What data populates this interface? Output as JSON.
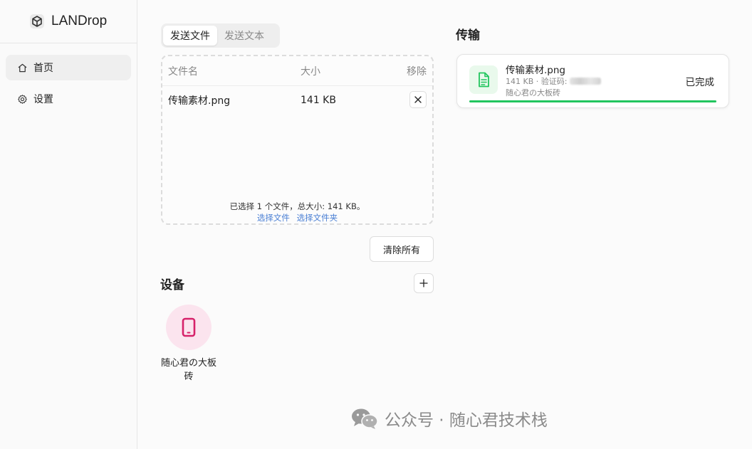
{
  "app": {
    "name": "LANDrop"
  },
  "sidebar": {
    "items": [
      {
        "label": "首页",
        "icon": "home-icon",
        "active": true
      },
      {
        "label": "设置",
        "icon": "gear-icon",
        "active": false
      }
    ]
  },
  "send": {
    "tabs": [
      {
        "label": "发送文件",
        "active": true
      },
      {
        "label": "发送文本",
        "active": false
      }
    ],
    "table": {
      "headers": {
        "name": "文件名",
        "size": "大小",
        "remove": "移除"
      },
      "rows": [
        {
          "name": "传输素材.png",
          "size": "141 KB"
        }
      ]
    },
    "summary": "已选择 1 个文件，总大小: 141 KB。",
    "links": {
      "select_files": "选择文件",
      "select_folder": "选择文件夹"
    },
    "clear_label": "清除所有"
  },
  "devices": {
    "title": "设备",
    "items": [
      {
        "name": "随心君の大板砖",
        "icon": "smartphone-icon"
      }
    ]
  },
  "transfers": {
    "title": "传输",
    "items": [
      {
        "file": "传输素材.png",
        "meta": "141 KB · 验证码:",
        "device": "随心君の大板砖",
        "status": "已完成",
        "progress": 1.0,
        "icon": "document-icon"
      }
    ]
  },
  "watermark": {
    "text": "公众号 · 随心君技术栈",
    "icon": "wechat-icon"
  },
  "colors": {
    "accent_link": "#4a7fd4",
    "progress": "#22c55e",
    "device_avatar_bg": "#fbe4ee",
    "device_icon": "#d6226a"
  }
}
